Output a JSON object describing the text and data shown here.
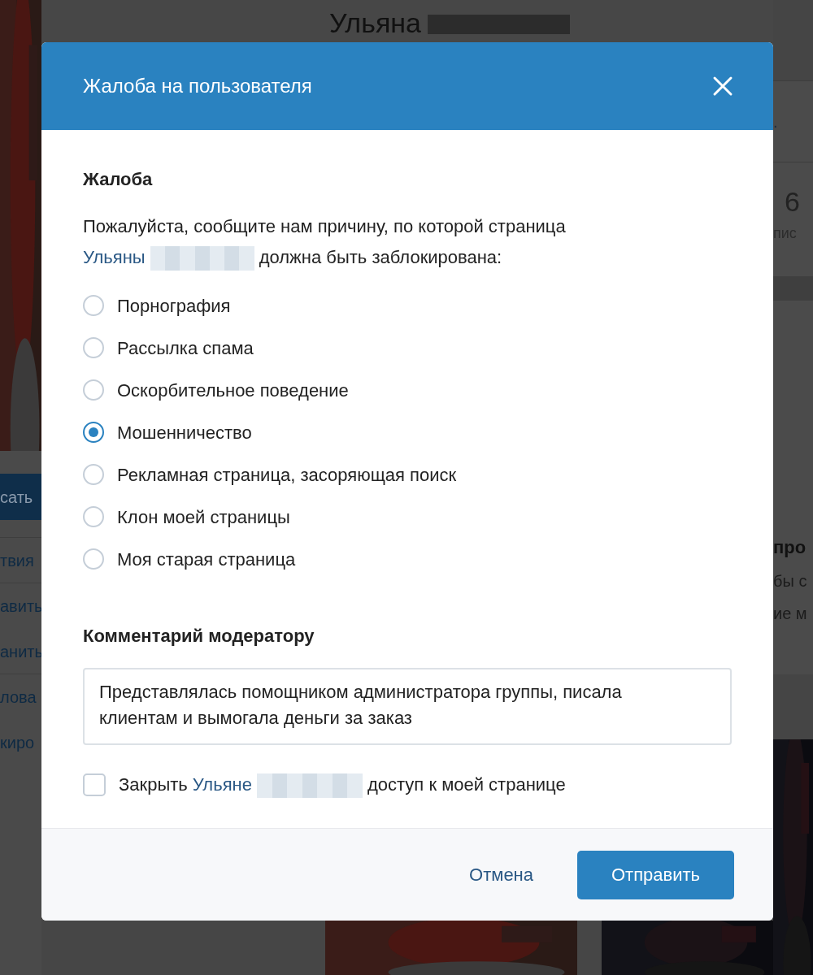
{
  "background": {
    "profile_name": "Ульяна",
    "left_button": "сать",
    "left_items": [
      "твия",
      "авить",
      "анить",
      "лова",
      "киро"
    ],
    "right_texts": [
      ".",
      "6",
      "пис"
    ],
    "right_heading": "про",
    "right_lines": [
      "бы с",
      "ие м"
    ]
  },
  "dialog": {
    "title": "Жалоба на пользователя",
    "section_title": "Жалоба",
    "prompt_before": "Пожалуйста, сообщите нам причину, по которой страница",
    "prompt_link": "Ульяны",
    "prompt_after": "должна быть заблокирована:",
    "reasons": [
      {
        "label": "Порнография",
        "selected": false
      },
      {
        "label": "Рассылка спама",
        "selected": false
      },
      {
        "label": "Оскорбительное поведение",
        "selected": false
      },
      {
        "label": "Мошенничество",
        "selected": true
      },
      {
        "label": "Рекламная страница, засоряющая поиск",
        "selected": false
      },
      {
        "label": "Клон моей страницы",
        "selected": false
      },
      {
        "label": "Моя старая страница",
        "selected": false
      }
    ],
    "comment_label": "Комментарий модератору",
    "comment_value": "Представлялась помощником администратора группы, писала клиентам и вымогала деньги за заказ",
    "block_access": {
      "checked": false,
      "before": "Закрыть",
      "link": "Ульяне",
      "after": "доступ к моей странице"
    },
    "buttons": {
      "cancel": "Отмена",
      "submit": "Отправить"
    }
  }
}
